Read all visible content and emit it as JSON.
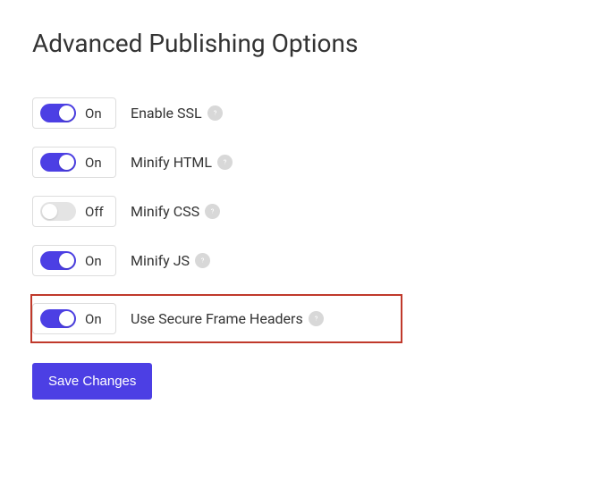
{
  "title": "Advanced Publishing Options",
  "options": [
    {
      "id": "enable-ssl",
      "state": "on",
      "state_label": "On",
      "label": "Enable SSL",
      "highlighted": false
    },
    {
      "id": "minify-html",
      "state": "on",
      "state_label": "On",
      "label": "Minify HTML",
      "highlighted": false
    },
    {
      "id": "minify-css",
      "state": "off",
      "state_label": "Off",
      "label": "Minify CSS",
      "highlighted": false
    },
    {
      "id": "minify-js",
      "state": "on",
      "state_label": "On",
      "label": "Minify JS",
      "highlighted": false
    },
    {
      "id": "use-secure-frame-headers",
      "state": "on",
      "state_label": "On",
      "label": "Use Secure Frame Headers",
      "highlighted": true
    }
  ],
  "save_label": "Save Changes",
  "colors": {
    "accent": "#4c3fe4",
    "highlight_border": "#c0392b"
  }
}
